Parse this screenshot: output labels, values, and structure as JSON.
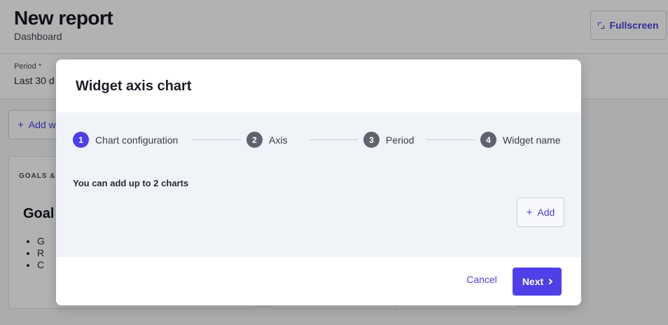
{
  "page": {
    "title": "New report",
    "subtitle": "Dashboard",
    "fullscreen_label": "Fullscreen",
    "period_label": "Period *",
    "period_value": "Last 30 d",
    "add_widget_label": "Add w",
    "card": {
      "label": "GOALS &",
      "heading": "Goal",
      "list_items": [
        "G",
        "R",
        "C"
      ]
    }
  },
  "modal": {
    "title": "Widget axis chart",
    "steps": [
      {
        "number": "1",
        "label": "Chart configuration",
        "active": true
      },
      {
        "number": "2",
        "label": "Axis",
        "active": false
      },
      {
        "number": "3",
        "label": "Period",
        "active": false
      },
      {
        "number": "4",
        "label": "Widget name",
        "active": false
      }
    ],
    "limit_text": "You can add up to 2 charts",
    "add_label": "Add",
    "cancel_label": "Cancel",
    "next_label": "Next"
  },
  "colors": {
    "accent": "#4f3fe8",
    "link": "#4b3fd9",
    "inactive_step": "#5f6370"
  }
}
